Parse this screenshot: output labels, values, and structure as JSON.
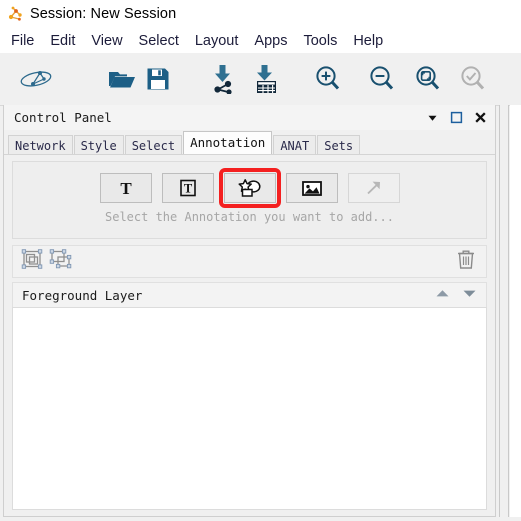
{
  "window": {
    "title": "Session: New Session",
    "app_icon": "cytoscape-logo-icon"
  },
  "menubar": {
    "items": [
      {
        "label": "File"
      },
      {
        "label": "Edit"
      },
      {
        "label": "View"
      },
      {
        "label": "Select"
      },
      {
        "label": "Layout"
      },
      {
        "label": "Apps"
      },
      {
        "label": "Tools"
      },
      {
        "label": "Help"
      }
    ]
  },
  "toolbar": {
    "buttons": [
      {
        "name": "new-network-icon",
        "tooltip": "Create New Network",
        "enabled": true
      },
      {
        "name": "open-folder-icon",
        "tooltip": "Open Session",
        "enabled": true
      },
      {
        "name": "save-floppy-icon",
        "tooltip": "Save Session",
        "enabled": true
      },
      {
        "name": "import-network-icon",
        "tooltip": "Import Network From File",
        "enabled": true
      },
      {
        "name": "import-table-icon",
        "tooltip": "Import Table From File",
        "enabled": true
      },
      {
        "name": "zoom-in-icon",
        "tooltip": "Zoom In",
        "enabled": true
      },
      {
        "name": "zoom-out-icon",
        "tooltip": "Zoom Out",
        "enabled": true
      },
      {
        "name": "fit-network-icon",
        "tooltip": "Zoom Out to Display All of Current Network",
        "enabled": true
      },
      {
        "name": "fit-selected-icon",
        "tooltip": "Zoom Selected Region",
        "enabled": false
      }
    ]
  },
  "control_panel": {
    "title": "Control Panel",
    "controls": [
      {
        "name": "panel-menu-chevron-icon",
        "glyph": "dropdown"
      },
      {
        "name": "panel-float-icon",
        "glyph": "square"
      },
      {
        "name": "panel-close-icon",
        "glyph": "close"
      }
    ],
    "tabs": [
      {
        "label": "Network",
        "active": false
      },
      {
        "label": "Style",
        "active": false
      },
      {
        "label": "Select",
        "active": false
      },
      {
        "label": "Annotation",
        "active": true
      },
      {
        "label": "ANAT",
        "active": false
      },
      {
        "label": "Sets",
        "active": false
      }
    ]
  },
  "annotation_panel": {
    "hint": "Select the Annotation you want to add...",
    "highlight_color": "#f42020",
    "buttons": [
      {
        "name": "add-text-annotation-button",
        "icon": "text-T-icon",
        "enabled": true,
        "highlighted": false
      },
      {
        "name": "add-bounded-text-annotation-button",
        "icon": "bounded-text-icon",
        "enabled": true,
        "highlighted": false
      },
      {
        "name": "add-shape-annotation-button",
        "icon": "shape-star-ellipse-icon",
        "enabled": true,
        "highlighted": true
      },
      {
        "name": "add-image-annotation-button",
        "icon": "image-picture-icon",
        "enabled": true,
        "highlighted": false
      },
      {
        "name": "add-arrow-annotation-button",
        "icon": "arrow-diagonal-icon",
        "enabled": false,
        "highlighted": false
      }
    ],
    "layer_tools": [
      {
        "name": "group-annotations-button",
        "icon": "group-icon",
        "enabled": true
      },
      {
        "name": "ungroup-annotations-button",
        "icon": "ungroup-icon",
        "enabled": true
      },
      {
        "name": "delete-annotation-button",
        "icon": "trash-icon",
        "enabled": true
      }
    ],
    "layer": {
      "name": "Foreground Layer",
      "move_up": "move-up-arrow-icon",
      "move_down": "move-down-arrow-icon",
      "items": []
    }
  }
}
